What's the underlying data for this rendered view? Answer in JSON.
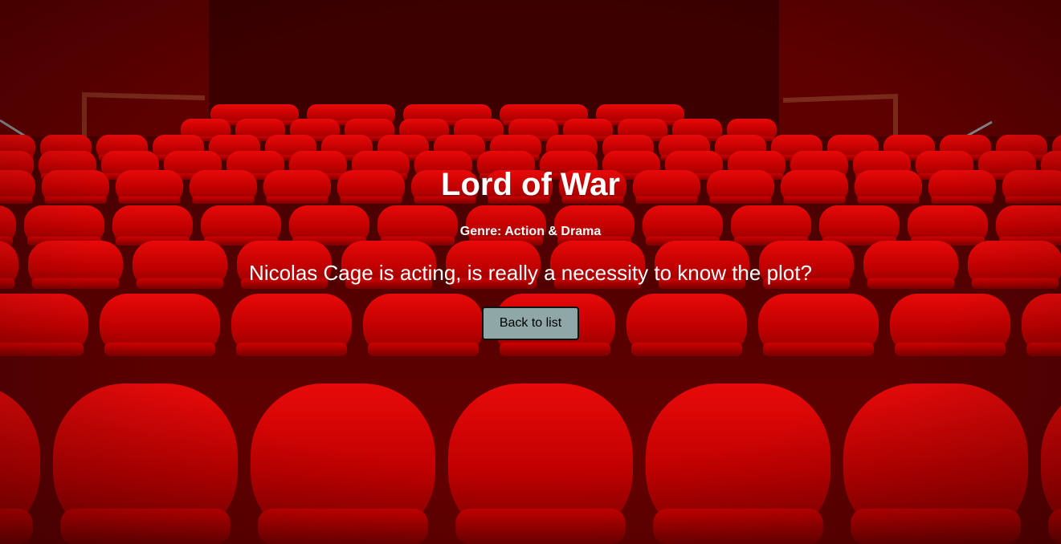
{
  "movie": {
    "title": "Lord of War",
    "genre_label": "Genre: Action & Drama",
    "plot": "Nicolas Cage is acting, is really a necessity to know the plot?"
  },
  "actions": {
    "back_label": "Back to list"
  },
  "background": {
    "image": "theater-seats-photo",
    "seat_color": "#c40000",
    "wall_color": "#5a0000"
  }
}
